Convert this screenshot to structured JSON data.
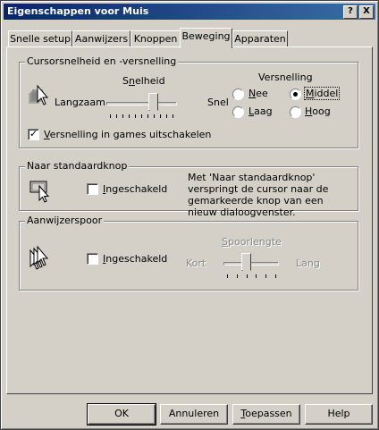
{
  "window": {
    "title": "Eigenschappen voor Muis",
    "help_btn": "?",
    "close_btn": "X"
  },
  "tabs": [
    {
      "label": "Snelle setup"
    },
    {
      "label": "Aanwijzers"
    },
    {
      "label": "Knoppen"
    },
    {
      "label": "Beweging",
      "active": true
    },
    {
      "label": "Apparaten"
    }
  ],
  "speed_group": {
    "title": "Cursorsnelheid en -versnelling",
    "speed_label": "Snelheid",
    "slow_label": "Langzaam",
    "fast_label": "Snel",
    "speed_value": 0.7,
    "accel_label": "Versnelling",
    "accel_options": [
      {
        "label": "Nee",
        "selected": false
      },
      {
        "label": "Middel",
        "selected": true
      },
      {
        "label": "Laag",
        "selected": false
      },
      {
        "label": "Hoog",
        "selected": false
      }
    ],
    "games_checkbox": {
      "label": "Versnelling in games uitschakelen",
      "checked": true
    }
  },
  "snap_group": {
    "title": "Naar standaardknop",
    "checkbox": {
      "label": "Ingeschakeld",
      "checked": false
    },
    "description": "Met 'Naar standaardknop' verspringt de cursor naar de gemarkeerde knop van een nieuw dialoogvenster."
  },
  "trail_group": {
    "title": "Aanwijzerspoor",
    "checkbox": {
      "label": "Ingeschakeld",
      "checked": false
    },
    "trail_label": "Spoorlengte",
    "short_label": "Kort",
    "long_label": "Lang",
    "trail_value": 0.4
  },
  "buttons": {
    "ok": "OK",
    "cancel": "Annuleren",
    "apply": "Toepassen",
    "help": "Help"
  }
}
